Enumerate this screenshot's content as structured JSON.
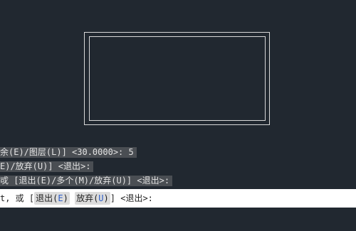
{
  "history": [
    "余(E)/图层(L)] <30.0000>: 5",
    "E)/放弃(U)] <退出>:",
    "戓 [退出(E)/多个(M)/放弃(U)] <退出>:"
  ],
  "command": {
    "prefix": "t, 或 [",
    "option_exit_label": "退出(",
    "option_exit_key": "E",
    "option_exit_close": ")",
    "option_undo_label": "放弃(",
    "option_undo_key": "U",
    "option_undo_close": ")",
    "suffix": "] <退出>:"
  },
  "colors": {
    "canvas": "#212830",
    "history_bg": "#4a4e53",
    "command_bg": "#ffffff",
    "option_key": "#2a5cc7"
  }
}
